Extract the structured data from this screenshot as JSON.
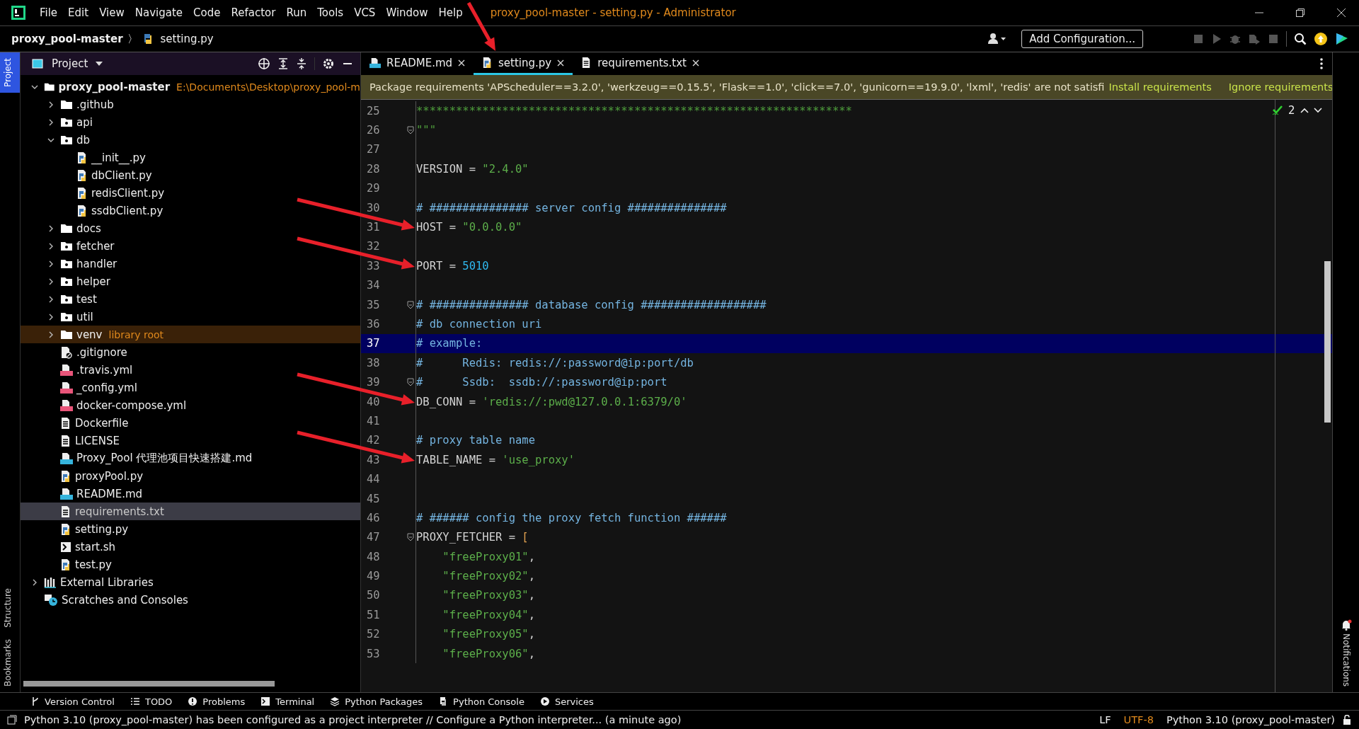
{
  "window": {
    "title": "proxy_pool-master - setting.py - Administrator"
  },
  "menu": [
    "File",
    "Edit",
    "View",
    "Navigate",
    "Code",
    "Refactor",
    "Run",
    "Tools",
    "VCS",
    "Window",
    "Help"
  ],
  "breadcrumb": {
    "project": "proxy_pool-master",
    "separator": "〉",
    "file": "setting.py"
  },
  "toolbar": {
    "run_config": "Add Configuration..."
  },
  "left_strip": [
    {
      "label": "Project",
      "selected": true
    },
    {
      "label": "Structure",
      "selected": false
    },
    {
      "label": "Bookmarks",
      "selected": false
    }
  ],
  "project_panel": {
    "title": "Project",
    "tree": [
      {
        "name": "proxy_pool-master",
        "kind": "folder",
        "path": "E:\\Documents\\Desktop\\proxy_pool-m",
        "expanded": true,
        "selected": false,
        "children": [
          {
            "name": ".github",
            "kind": "folder",
            "expanded": false,
            "selected": false
          },
          {
            "name": "api",
            "kind": "package",
            "expanded": false,
            "selected": false
          },
          {
            "name": "db",
            "kind": "package",
            "expanded": true,
            "selected": false,
            "children": [
              {
                "name": "__init__.py",
                "kind": "python",
                "selected": false
              },
              {
                "name": "dbClient.py",
                "kind": "python",
                "selected": false
              },
              {
                "name": "redisClient.py",
                "kind": "python",
                "selected": false
              },
              {
                "name": "ssdbClient.py",
                "kind": "python",
                "selected": false
              }
            ]
          },
          {
            "name": "docs",
            "kind": "folder",
            "expanded": false,
            "selected": false
          },
          {
            "name": "fetcher",
            "kind": "package",
            "expanded": false,
            "selected": false
          },
          {
            "name": "handler",
            "kind": "package",
            "expanded": false,
            "selected": false
          },
          {
            "name": "helper",
            "kind": "package",
            "expanded": false,
            "selected": false
          },
          {
            "name": "test",
            "kind": "package",
            "expanded": false,
            "selected": false
          },
          {
            "name": "util",
            "kind": "package",
            "expanded": false,
            "selected": false
          },
          {
            "name": "venv",
            "kind": "folder",
            "note": "library root",
            "expanded": false,
            "selected": false
          },
          {
            "name": ".gitignore",
            "kind": "gitignore",
            "selected": false
          },
          {
            "name": ".travis.yml",
            "kind": "yaml",
            "selected": false
          },
          {
            "name": "_config.yml",
            "kind": "yaml",
            "selected": false
          },
          {
            "name": "docker-compose.yml",
            "kind": "yaml",
            "selected": false
          },
          {
            "name": "Dockerfile",
            "kind": "text",
            "selected": false
          },
          {
            "name": "LICENSE",
            "kind": "text",
            "selected": false
          },
          {
            "name": "Proxy_Pool 代理池项目快速搭建.md",
            "kind": "markdown",
            "selected": false
          },
          {
            "name": "proxyPool.py",
            "kind": "python",
            "selected": false
          },
          {
            "name": "README.md",
            "kind": "markdown",
            "selected": false
          },
          {
            "name": "requirements.txt",
            "kind": "text",
            "selected": true
          },
          {
            "name": "setting.py",
            "kind": "python",
            "selected": false
          },
          {
            "name": "start.sh",
            "kind": "shell",
            "selected": false
          },
          {
            "name": "test.py",
            "kind": "python",
            "selected": false
          }
        ]
      },
      {
        "name": "External Libraries",
        "kind": "libraries",
        "expanded": false,
        "selected": false
      },
      {
        "name": "Scratches and Consoles",
        "kind": "scratches",
        "selected": false
      }
    ]
  },
  "tabs": [
    {
      "label": "README.md",
      "kind": "markdown",
      "selected": false
    },
    {
      "label": "setting.py",
      "kind": "python",
      "selected": true
    },
    {
      "label": "requirements.txt",
      "kind": "text",
      "selected": false
    }
  ],
  "banner": {
    "message": "Package requirements 'APScheduler==3.2.0', 'werkzeug==0.15.5', 'Flask==1.0', 'click==7.0', 'gunicorn==19.9.0', 'lxml', 'redis' are not satisfi",
    "actions": [
      "Install requirements",
      "Ignore requirements"
    ]
  },
  "inspections": {
    "count": "2"
  },
  "code_lines": [
    {
      "number": "25",
      "current": false,
      "fold": false,
      "tokens": [
        {
          "kind": "doc",
          "text": "******************************************************************"
        }
      ]
    },
    {
      "number": "26",
      "current": false,
      "fold": true,
      "tokens": [
        {
          "kind": "doc",
          "text": "\"\"\""
        }
      ]
    },
    {
      "number": "27",
      "current": false,
      "fold": false
    },
    {
      "number": "28",
      "current": false,
      "fold": false,
      "tokens": [
        {
          "kind": "plain",
          "text": "VERSION = "
        },
        {
          "kind": "string",
          "text": "\"2.4.0\""
        }
      ]
    },
    {
      "number": "29",
      "current": false,
      "fold": false
    },
    {
      "number": "30",
      "current": false,
      "fold": false,
      "tokens": [
        {
          "kind": "comment",
          "text": "# ############### server config ###############"
        }
      ]
    },
    {
      "number": "31",
      "current": false,
      "fold": false,
      "tokens": [
        {
          "kind": "plain",
          "text": "HOST = "
        },
        {
          "kind": "string",
          "text": "\"0.0.0.0\""
        }
      ]
    },
    {
      "number": "32",
      "current": false,
      "fold": false
    },
    {
      "number": "33",
      "current": false,
      "fold": false,
      "tokens": [
        {
          "kind": "plain",
          "text": "PORT = "
        },
        {
          "kind": "number",
          "text": "5010"
        }
      ]
    },
    {
      "number": "34",
      "current": false,
      "fold": false
    },
    {
      "number": "35",
      "current": false,
      "fold": true,
      "tokens": [
        {
          "kind": "comment",
          "text": "# ############### database config ###################"
        }
      ]
    },
    {
      "number": "36",
      "current": false,
      "fold": false,
      "tokens": [
        {
          "kind": "comment",
          "text": "# db connection uri"
        }
      ]
    },
    {
      "number": "37",
      "current": true,
      "fold": false,
      "tokens": [
        {
          "kind": "comment",
          "text": "# example:"
        }
      ]
    },
    {
      "number": "38",
      "current": false,
      "fold": false,
      "tokens": [
        {
          "kind": "comment",
          "text": "#      Redis: redis://:password@ip:port/db"
        }
      ]
    },
    {
      "number": "39",
      "current": false,
      "fold": true,
      "tokens": [
        {
          "kind": "comment",
          "text": "#      Ssdb:  ssdb://:password@ip:port"
        }
      ]
    },
    {
      "number": "40",
      "current": false,
      "fold": false,
      "tokens": [
        {
          "kind": "plain",
          "text": "DB_CONN = "
        },
        {
          "kind": "string",
          "text": "'redis://:pwd@127.0.0.1:6379/0'"
        }
      ]
    },
    {
      "number": "41",
      "current": false,
      "fold": false
    },
    {
      "number": "42",
      "current": false,
      "fold": false,
      "tokens": [
        {
          "kind": "comment",
          "text": "# proxy table name"
        }
      ]
    },
    {
      "number": "43",
      "current": false,
      "fold": false,
      "tokens": [
        {
          "kind": "plain",
          "text": "TABLE_NAME = "
        },
        {
          "kind": "string",
          "text": "'use_proxy'"
        }
      ]
    },
    {
      "number": "44",
      "current": false,
      "fold": false
    },
    {
      "number": "45",
      "current": false,
      "fold": false
    },
    {
      "number": "46",
      "current": false,
      "fold": false,
      "tokens": [
        {
          "kind": "comment",
          "text": "# ###### config the proxy fetch function ######"
        }
      ]
    },
    {
      "number": "47",
      "current": false,
      "fold": true,
      "tokens": [
        {
          "kind": "plain",
          "text": "PROXY_FETCHER = "
        },
        {
          "kind": "bracket",
          "text": "["
        }
      ]
    },
    {
      "number": "48",
      "current": false,
      "fold": false,
      "tokens": [
        {
          "kind": "string",
          "text": "    \"freeProxy01\""
        },
        {
          "kind": "plain",
          "text": ","
        }
      ]
    },
    {
      "number": "49",
      "current": false,
      "fold": false,
      "tokens": [
        {
          "kind": "string",
          "text": "    \"freeProxy02\""
        },
        {
          "kind": "plain",
          "text": ","
        }
      ]
    },
    {
      "number": "50",
      "current": false,
      "fold": false,
      "tokens": [
        {
          "kind": "string",
          "text": "    \"freeProxy03\""
        },
        {
          "kind": "plain",
          "text": ","
        }
      ]
    },
    {
      "number": "51",
      "current": false,
      "fold": false,
      "tokens": [
        {
          "kind": "string",
          "text": "    \"freeProxy04\""
        },
        {
          "kind": "plain",
          "text": ","
        }
      ]
    },
    {
      "number": "52",
      "current": false,
      "fold": false,
      "tokens": [
        {
          "kind": "string",
          "text": "    \"freeProxy05\""
        },
        {
          "kind": "plain",
          "text": ","
        }
      ]
    },
    {
      "number": "53",
      "current": false,
      "fold": false,
      "tokens": [
        {
          "kind": "string",
          "text": "    \"freeProxy06\""
        },
        {
          "kind": "plain",
          "text": ","
        }
      ]
    }
  ],
  "right_strip": [
    {
      "label": "Notifications"
    }
  ],
  "tool_buttons": [
    {
      "label": "Version Control",
      "kind": "vcs"
    },
    {
      "label": "TODO",
      "kind": "todo"
    },
    {
      "label": "Problems",
      "kind": "problems"
    },
    {
      "label": "Terminal",
      "kind": "terminal"
    },
    {
      "label": "Python Packages",
      "kind": "packages"
    },
    {
      "label": "Python Console",
      "kind": "console"
    },
    {
      "label": "Services",
      "kind": "services"
    }
  ],
  "status_bar": {
    "message": "Python 3.10 (proxy_pool-master) has been configured as a project interpreter // Configure a Python interpreter... (a minute ago)",
    "line_separator": "LF",
    "encoding": "UTF-8",
    "interpreter": "Python 3.10 (proxy_pool-master)"
  }
}
